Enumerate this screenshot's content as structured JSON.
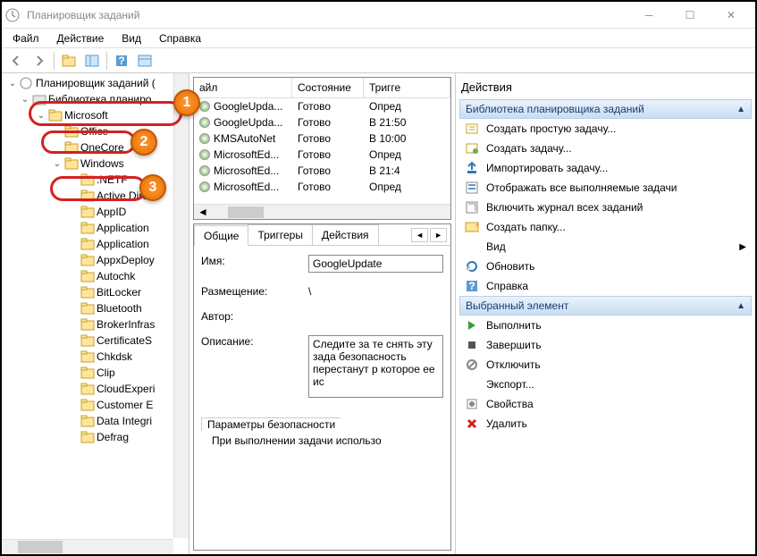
{
  "window": {
    "title": "Планировщик заданий"
  },
  "menu": {
    "file": "Файл",
    "action": "Действие",
    "view": "Вид",
    "help": "Справка"
  },
  "tree": {
    "root": "Планировщик заданий (",
    "lib": "Библиотека планиро",
    "microsoft": "Microsoft",
    "office": "Office",
    "onecore": "OneCore",
    "windows": "Windows",
    "sub": [
      ".NETF",
      "Active Dire",
      "AppID",
      "Application",
      "Application",
      "AppxDeploy",
      "Autochk",
      "BitLocker",
      "Bluetooth",
      "BrokerInfras",
      "CertificateS",
      "Chkdsk",
      "Clip",
      "CloudExperi",
      "Customer E",
      "Data Integri",
      "Defrag"
    ]
  },
  "taskCols": {
    "name": "айл",
    "state": "Состояние",
    "trigger": "Тригге"
  },
  "tasks": [
    {
      "name": "GoogleUpda...",
      "state": "Готово",
      "trigger": "Опред",
      "color": "#6ab04c"
    },
    {
      "name": "GoogleUpda...",
      "state": "Готово",
      "trigger": "В 21:50",
      "color": "#6ab04c"
    },
    {
      "name": "KMSAutoNet",
      "state": "Готово",
      "trigger": "В 10:00",
      "color": "#6ab04c"
    },
    {
      "name": "MicrosoftEd...",
      "state": "Готово",
      "trigger": "Опред",
      "color": "#6ab04c"
    },
    {
      "name": "MicrosoftEd...",
      "state": "Готово",
      "trigger": "В 21:4",
      "color": "#6ab04c"
    },
    {
      "name": "MicrosoftEd...",
      "state": "Готово",
      "trigger": "Опред",
      "color": "#6ab04c"
    }
  ],
  "tabs": {
    "general": "Общие",
    "triggers": "Триггеры",
    "actions": "Действия"
  },
  "detail": {
    "nameLabel": "Имя:",
    "nameValue": "GoogleUpdate",
    "locationLabel": "Размещение:",
    "locationValue": "\\",
    "authorLabel": "Автор:",
    "descLabel": "Описание:",
    "descValue": "Следите за те снять эту зада безопасность перестанут р которое ее ис",
    "securityParams": "Параметры безопасности",
    "runWhen": "При выполнении задачи использо"
  },
  "actions": {
    "title": "Действия",
    "section1": "Библиотека планировщика заданий",
    "items1": [
      "Создать простую задачу...",
      "Создать задачу...",
      "Импортировать задачу...",
      "Отображать все выполняемые задачи",
      "Включить журнал всех заданий",
      "Создать папку..."
    ],
    "viewItem": "Вид",
    "refresh": "Обновить",
    "help": "Справка",
    "section2": "Выбранный элемент",
    "items2": [
      "Выполнить",
      "Завершить",
      "Отключить",
      "Экспорт...",
      "Свойства",
      "Удалить"
    ]
  },
  "callouts": {
    "b1": "1",
    "b2": "2",
    "b3": "3"
  }
}
